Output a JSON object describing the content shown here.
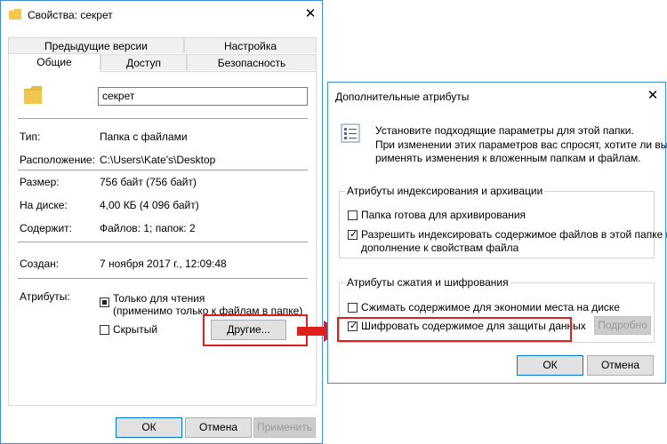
{
  "properties": {
    "title": "Свойства: секрет",
    "tabs_top": [
      "Предыдущие версии",
      "Настройка"
    ],
    "tabs_bottom": [
      "Общие",
      "Доступ",
      "Безопасность"
    ],
    "name_value": "секрет",
    "fields": [
      {
        "label": "Тип:",
        "value": "Папка с файлами"
      },
      {
        "label": "Расположение:",
        "value": "C:\\Users\\Kate's\\Desktop"
      },
      {
        "label": "Размер:",
        "value": "756 байт (756 байт)"
      },
      {
        "label": "На диске:",
        "value": "4,00 КБ (4 096 байт)"
      },
      {
        "label": "Содержит:",
        "value": "Файлов: 1; папок: 2"
      },
      {
        "label": "Создан:",
        "value": "7 ноября 2017 г., 12:09:48"
      }
    ],
    "attributes_label": "Атрибуты:",
    "readonly_label": "Только для чтения",
    "readonly_note": "(применимо только к файлам в папке)",
    "hidden_label": "Скрытый",
    "other_button": "Другие...",
    "ok": "ОК",
    "cancel": "Отмена",
    "apply": "Применить"
  },
  "advanced": {
    "title": "Дополнительные атрибуты",
    "intro1": "Установите подходящие параметры для этой папки.",
    "intro2": "При изменении этих параметров вас спросят, хотите ли вы п",
    "intro3": "рименять изменения к вложенным папкам и файлам.",
    "group1_title": "Атрибуты индексирования и архивации",
    "archive_label": "Папка готова для архивирования",
    "index_label1": "Разрешить индексировать содержимое файлов в этой папке в",
    "index_label2": "дополнение к свойствам файла",
    "group2_title": "Атрибуты сжатия и шифрования",
    "compress_label": "Сжимать содержимое для экономии места на диске",
    "encrypt_label": "Шифровать содержимое для защиты данных",
    "details_button": "Подробно",
    "ok": "ОК",
    "cancel": "Отмена",
    "checked": {
      "archive": false,
      "index": true,
      "compress": false,
      "encrypt": true
    }
  },
  "colors": {
    "highlight": "#e0201c",
    "window_border": "#3f8fd6",
    "folder": "#f3c64e"
  },
  "icons": [
    "folder-icon",
    "close-icon",
    "attributes-list-icon",
    "arrow-right-icon"
  ]
}
